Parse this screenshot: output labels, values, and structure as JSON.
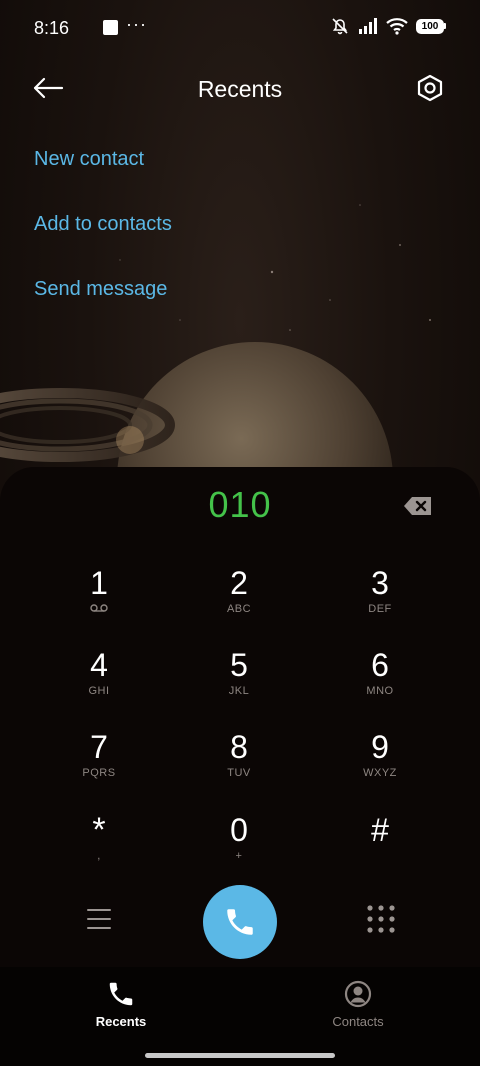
{
  "status_bar": {
    "time": "8:16",
    "notification_dots": "···",
    "battery": "100"
  },
  "header": {
    "title": "Recents",
    "back_icon": "arrow-left-icon",
    "settings_icon": "settings-hexagon-icon"
  },
  "actions": {
    "new_contact": "New contact",
    "add_to_contacts": "Add to contacts",
    "send_message": "Send message"
  },
  "dialer": {
    "number": "010",
    "keys": [
      {
        "digit": "1",
        "letters": ""
      },
      {
        "digit": "2",
        "letters": "ABC"
      },
      {
        "digit": "3",
        "letters": "DEF"
      },
      {
        "digit": "4",
        "letters": "GHI"
      },
      {
        "digit": "5",
        "letters": "JKL"
      },
      {
        "digit": "6",
        "letters": "MNO"
      },
      {
        "digit": "7",
        "letters": "PQRS"
      },
      {
        "digit": "8",
        "letters": "TUV"
      },
      {
        "digit": "9",
        "letters": "WXYZ"
      },
      {
        "digit": "*",
        "letters": ","
      },
      {
        "digit": "0",
        "letters": "+"
      },
      {
        "digit": "#",
        "letters": ""
      }
    ]
  },
  "bottom_nav": {
    "recents": "Recents",
    "contacts": "Contacts"
  },
  "colors": {
    "accent": "#5bb8e6",
    "number": "#44c24a",
    "panel": "#0b0605"
  }
}
